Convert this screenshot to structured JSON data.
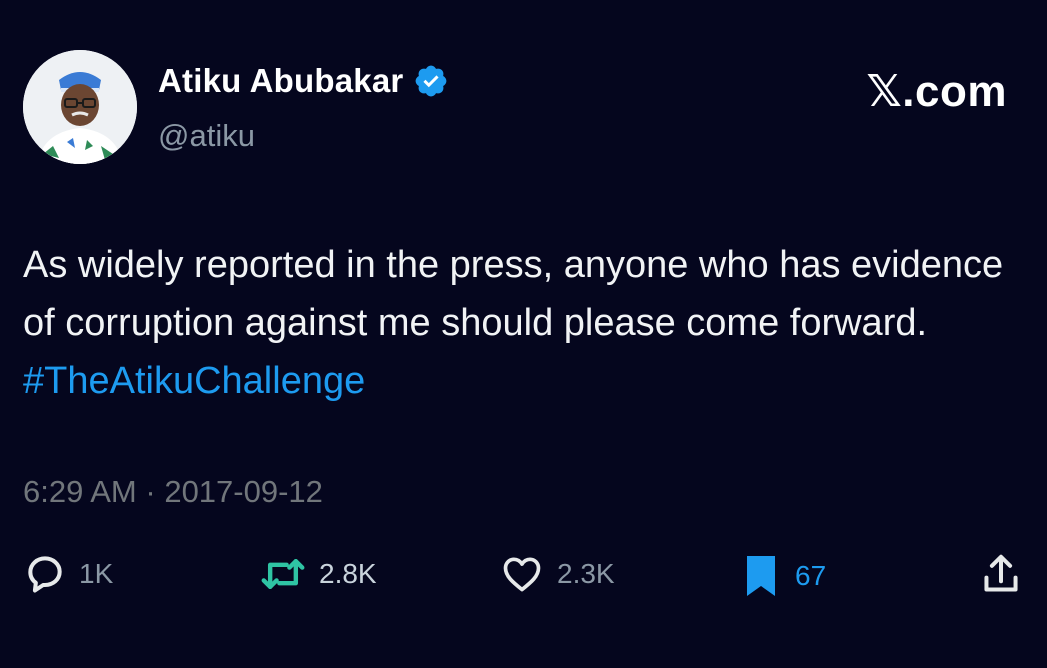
{
  "header": {
    "display_name": "Atiku Abubakar",
    "handle": "@atiku",
    "site_label": "𝕏.com"
  },
  "tweet": {
    "text_plain": "As widely reported in the press, anyone who has evidence of corruption against me should please come forward. ",
    "hashtag": "#TheAtikuChallenge"
  },
  "meta": {
    "time": "6:29 AM",
    "separator": "·",
    "date": "2017-09-12"
  },
  "actions": {
    "replies": "1K",
    "reposts": "2.8K",
    "likes": "2.3K",
    "bookmarks": "67"
  },
  "icons": {
    "verified": "verified-badge-icon",
    "reply": "reply-icon",
    "repost": "repost-icon",
    "like": "heart-icon",
    "bookmark": "bookmark-icon",
    "share": "share-icon"
  },
  "colors": {
    "background": "#05061e",
    "accent": "#1d9bf0",
    "muted": "#71767b"
  }
}
